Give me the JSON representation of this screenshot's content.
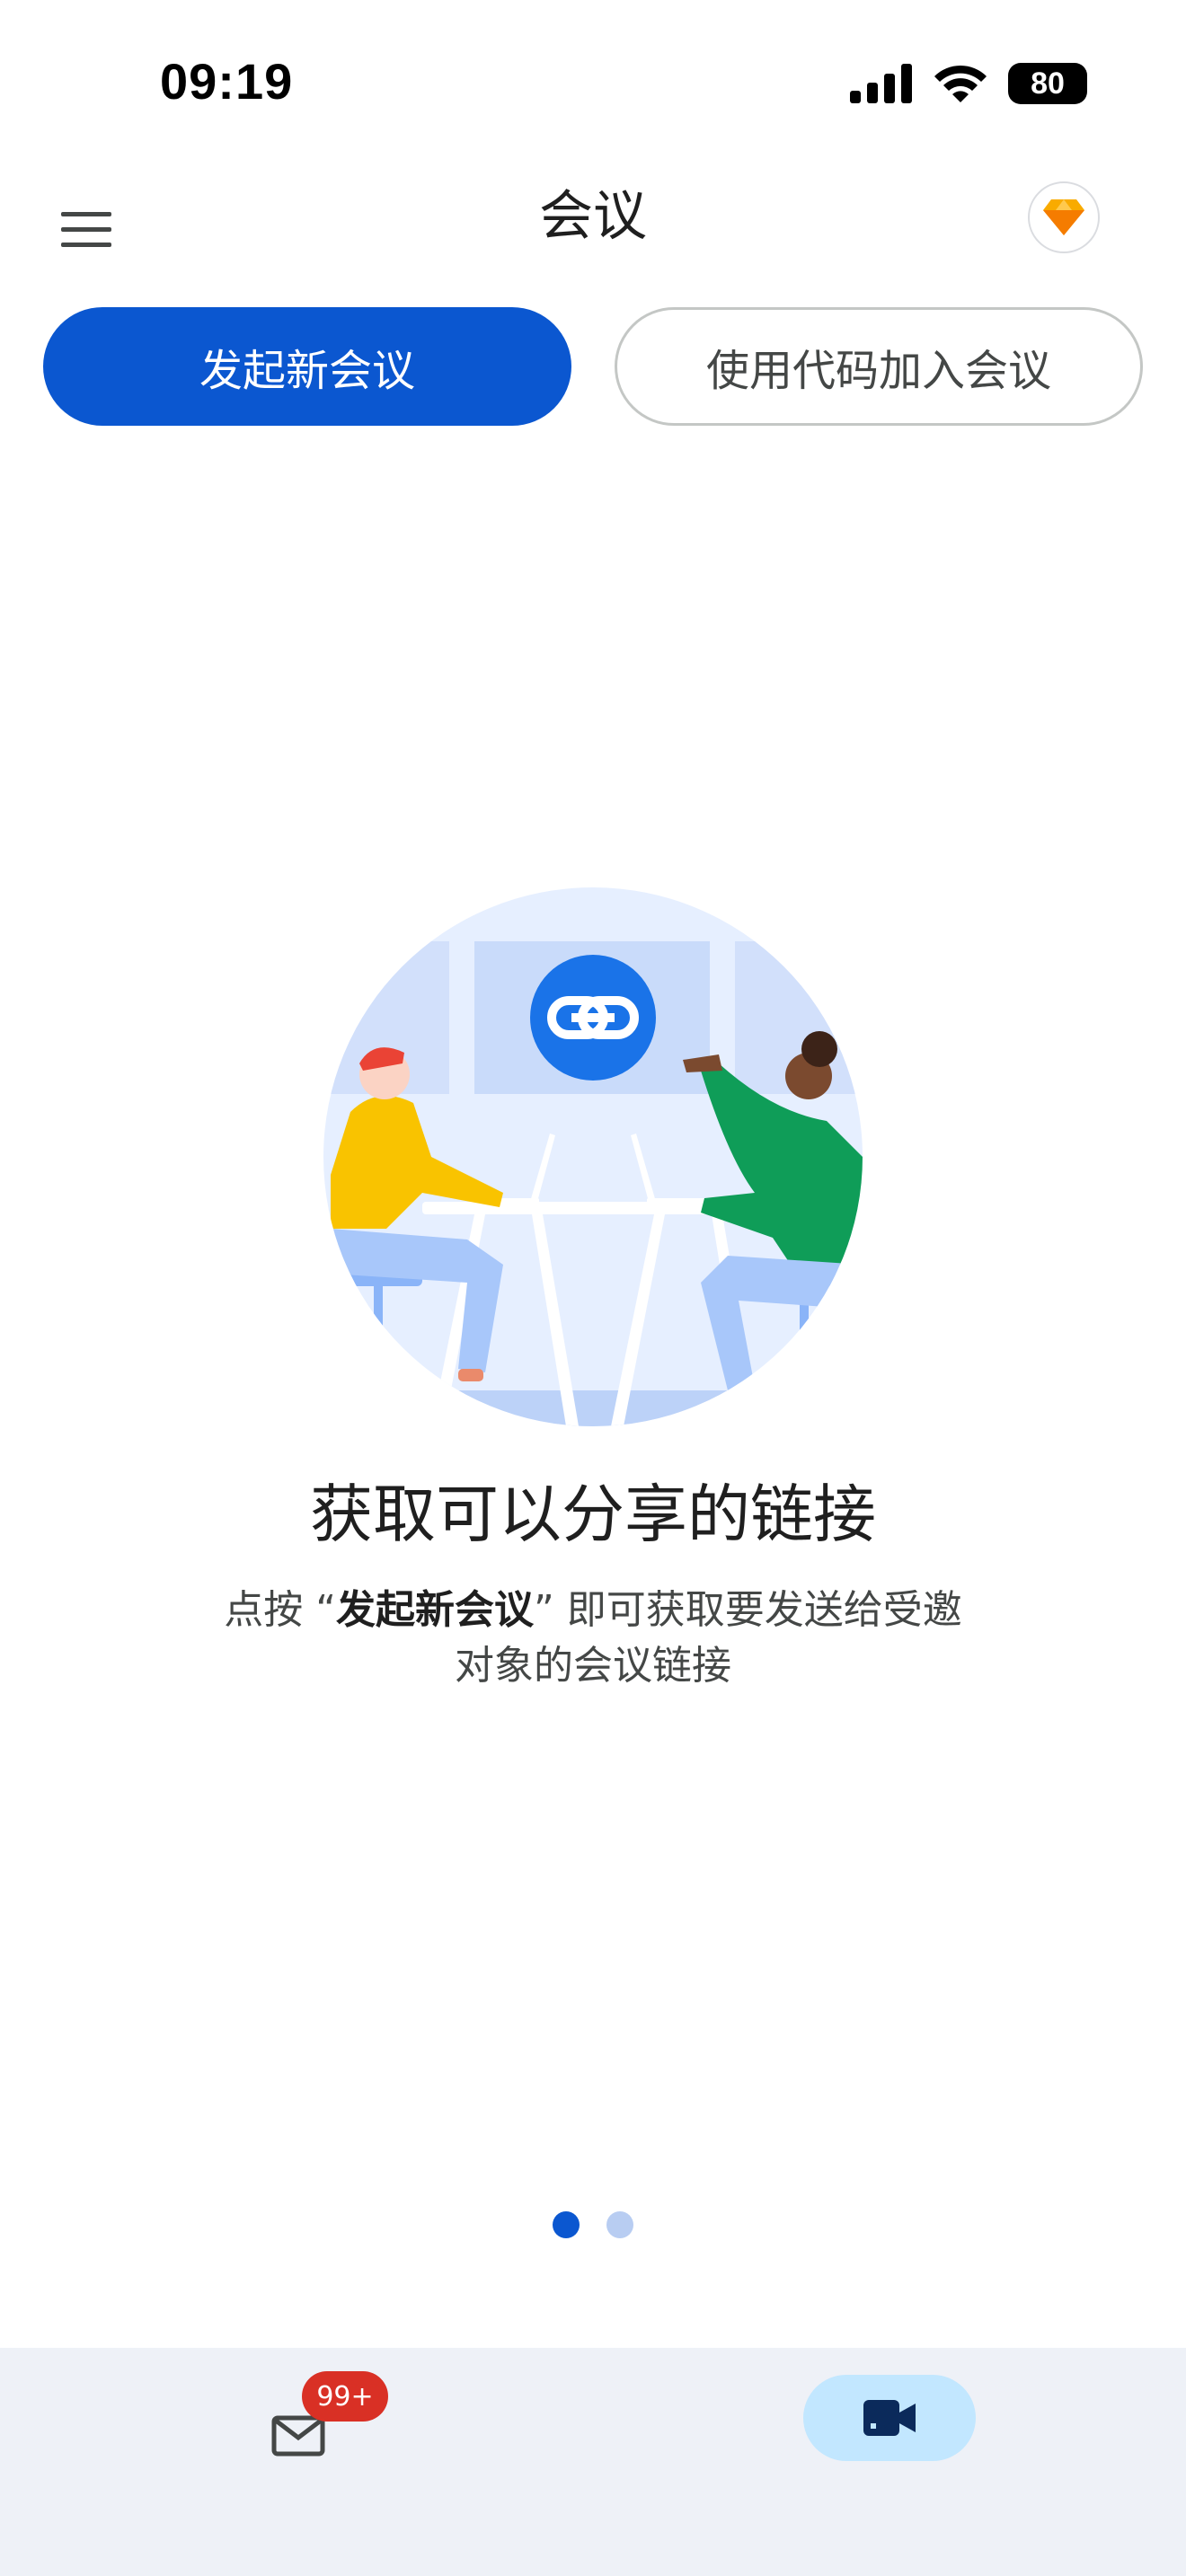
{
  "status_bar": {
    "time": "09:19",
    "battery": "80",
    "icons": [
      "cellular-signal-icon",
      "wifi-icon",
      "battery-icon"
    ]
  },
  "app_bar": {
    "title": "会议",
    "menu_icon": "hamburger-menu-icon",
    "premium_icon": "diamond-icon"
  },
  "actions": {
    "new_meeting_label": "发起新会议",
    "join_with_code_label": "使用代码加入会议"
  },
  "onboarding": {
    "title": "获取可以分享的链接",
    "desc_prefix": "点按",
    "desc_quote_open": "“",
    "desc_bold": "发起新会议",
    "desc_quote_close": "”",
    "desc_line1_suffix": " 即可获取要发送给受邀",
    "desc_line2": "对象的会议链接",
    "illustration": "two-people-sharing-link-illustration",
    "page_index": 1,
    "page_count": 2
  },
  "bottom_nav": {
    "mail_icon": "mail-icon",
    "mail_badge": "99+",
    "meet_icon": "video-camera-icon"
  },
  "colors": {
    "primary": "#0b57d0",
    "badge": "#d93025",
    "nav_background": "#eef1f7",
    "meet_active": "#c2e7ff",
    "premium_accent": "#f9ab00"
  }
}
